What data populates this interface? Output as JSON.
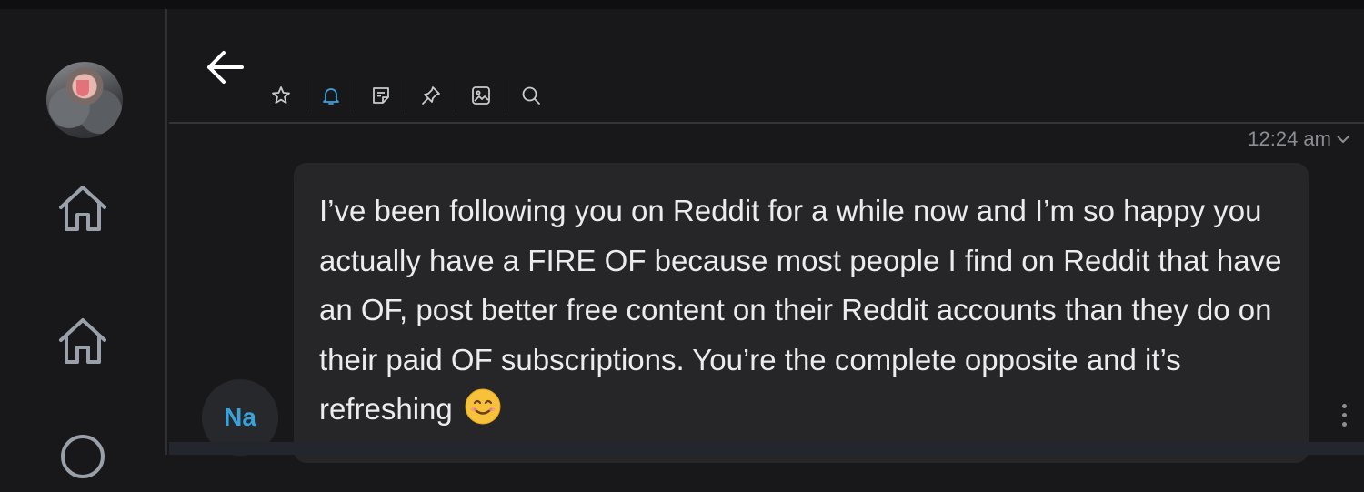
{
  "app": {
    "accent_color": "#3aa2db",
    "background_color": "#18181b"
  },
  "sidebar": {
    "avatar_icon": "user-avatar",
    "items": [
      {
        "icon": "home-icon"
      },
      {
        "icon": "home-icon"
      },
      {
        "icon": "search-icon"
      }
    ]
  },
  "header": {
    "back_icon": "arrow-left-icon",
    "toolbar": [
      {
        "icon": "star-icon",
        "active": false
      },
      {
        "icon": "bell-icon",
        "active": true
      },
      {
        "icon": "note-icon",
        "active": false
      },
      {
        "icon": "pin-icon",
        "active": false
      },
      {
        "icon": "image-icon",
        "active": false
      },
      {
        "icon": "search-icon",
        "active": false
      }
    ]
  },
  "chat": {
    "message": {
      "time": "12:24 am",
      "text": "I’ve been following you on Reddit for a while now and I’m so happy you actually have a FIRE OF because most people I find on Reddit that have an OF, post better free content on their Reddit accounts than they do on their paid OF subscriptions. You’re the complete opposite and it’s refreshing",
      "emoji": "😊",
      "sender_initials": "Na",
      "more_icon": "more-vertical-icon"
    }
  }
}
